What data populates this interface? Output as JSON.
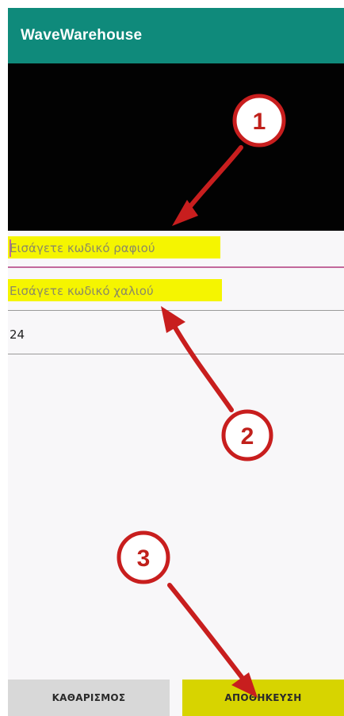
{
  "app_bar": {
    "title": "WaveWarehouse"
  },
  "form": {
    "shelf_code": {
      "placeholder": "Εισάγετε κωδικό ραφιού",
      "value": ""
    },
    "carpet_code": {
      "placeholder": "Εισάγετε κωδικό χαλιού",
      "value": ""
    },
    "quantity": {
      "value": "24"
    }
  },
  "buttons": {
    "clear_label": "ΚΑΘΑΡΙΣΜΟΣ",
    "save_label": "ΑΠΟΘΗΚΕΥΣΗ"
  },
  "annotations": [
    {
      "number": "1",
      "target": "shelf-code-input"
    },
    {
      "number": "2",
      "target": "carpet-code-input"
    },
    {
      "number": "3",
      "target": "save-button"
    }
  ],
  "colors": {
    "app_bar": "#0f8a7b",
    "highlight": "#f5f500",
    "focus_accent": "#c2689b",
    "save_button": "#d7d400",
    "clear_button": "#d8d8d8",
    "annotation": "#c0201b"
  }
}
